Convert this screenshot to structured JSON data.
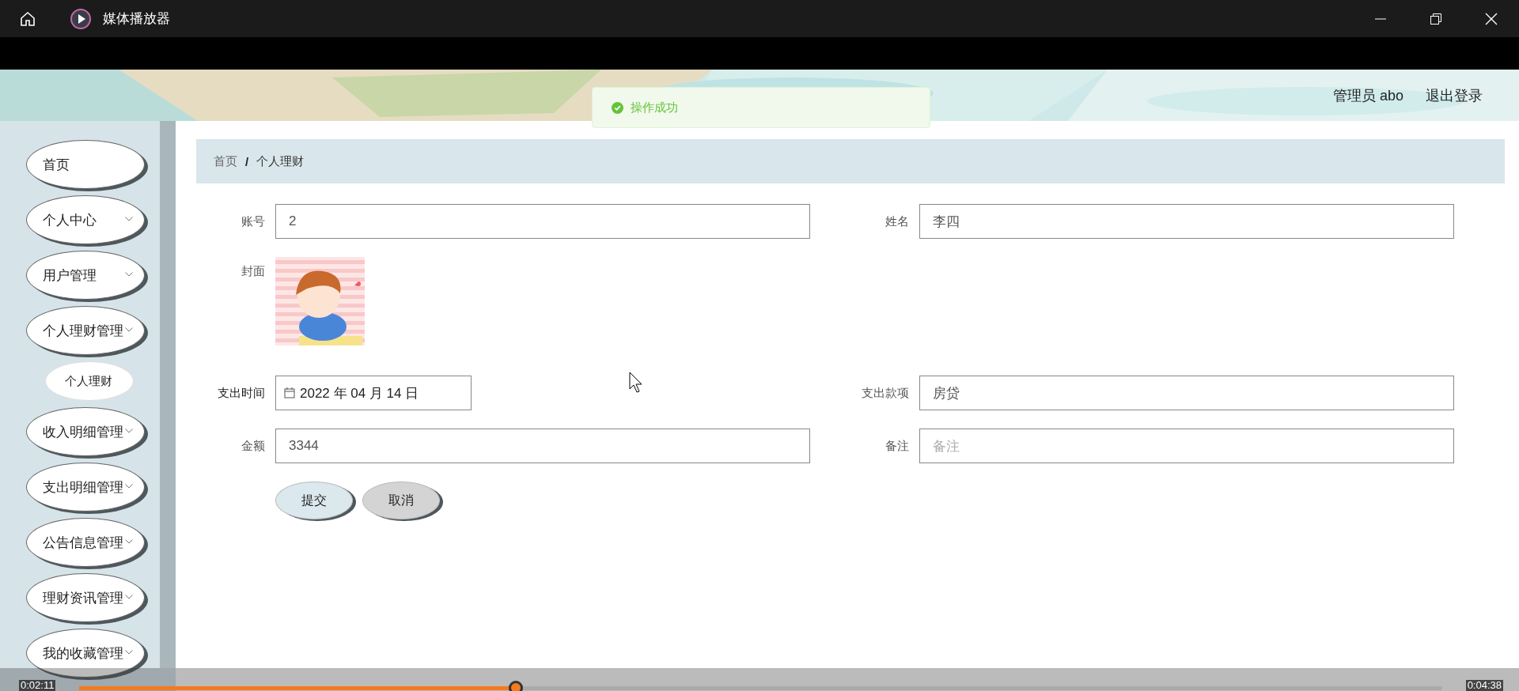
{
  "window": {
    "title": "媒体播放器"
  },
  "header": {
    "user": "管理员 abo",
    "logout": "退出登录"
  },
  "toast": {
    "message": "操作成功"
  },
  "sidebar": {
    "items": [
      {
        "label": "首页",
        "kind": "link"
      },
      {
        "label": "个人中心",
        "kind": "menu"
      },
      {
        "label": "用户管理",
        "kind": "menu"
      },
      {
        "label": "个人理财管理",
        "kind": "menu"
      },
      {
        "label": "个人理财",
        "kind": "subitem"
      },
      {
        "label": "收入明细管理",
        "kind": "menu"
      },
      {
        "label": "支出明细管理",
        "kind": "menu"
      },
      {
        "label": "公告信息管理",
        "kind": "menu"
      },
      {
        "label": "理财资讯管理",
        "kind": "menu"
      },
      {
        "label": "我的收藏管理",
        "kind": "menu"
      }
    ]
  },
  "breadcrumb": {
    "items": [
      "首页",
      "个人理财"
    ],
    "separator": "/"
  },
  "form": {
    "rows": [
      [
        {
          "label": "账号",
          "kind": "text",
          "value": "2"
        },
        {
          "label": "姓名",
          "kind": "text",
          "value": "李四"
        }
      ],
      [
        {
          "label": "封面"
        }
      ],
      [
        {
          "label": "支出时间",
          "kind": "date",
          "value": "2022 年 04 月 14 日"
        },
        {
          "label": "支出款项",
          "kind": "text",
          "value": "房贷"
        }
      ],
      [
        {
          "label": "金额",
          "kind": "text",
          "value": "3344"
        },
        {
          "label": "备注",
          "kind": "text",
          "placeholder": "备注"
        }
      ]
    ],
    "buttons": [
      {
        "label": "提交",
        "kind": "primary"
      },
      {
        "label": "取消",
        "kind": "cancel"
      }
    ]
  },
  "player": {
    "current": "0:02:11",
    "total": "0:04:38",
    "level": 0.32
  }
}
